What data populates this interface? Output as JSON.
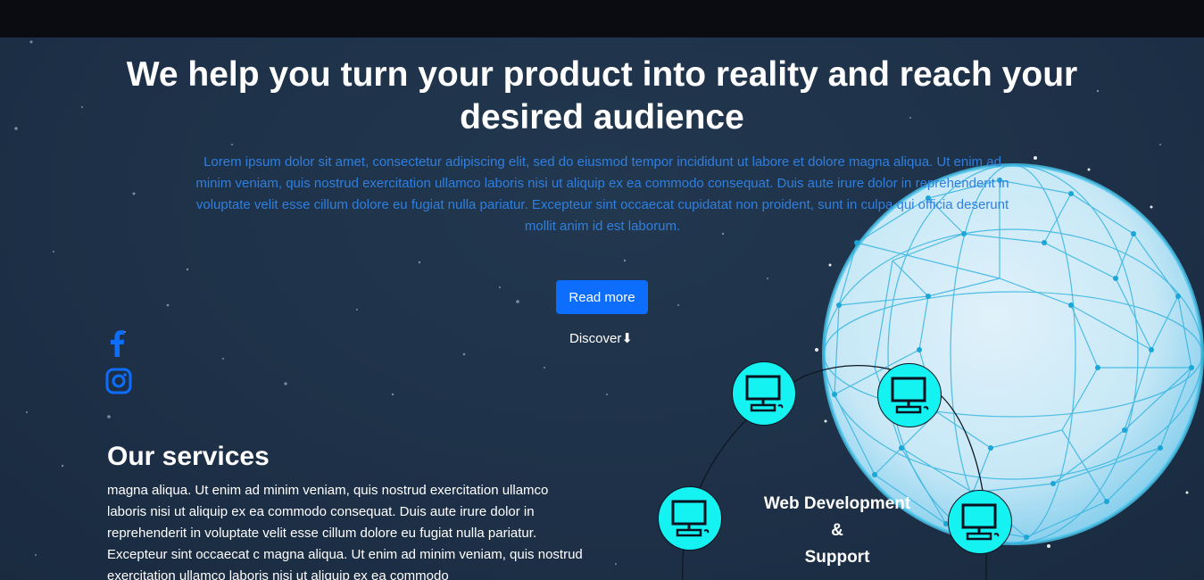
{
  "hero": {
    "headline": "We help you turn your product into reality and reach your desired audience",
    "lead": "Lorem ipsum dolor sit amet, consectetur adipiscing elit, sed do eiusmod tempor incididunt ut labore et dolore magna aliqua. Ut enim ad minim veniam, quis nostrud exercitation ullamco laboris nisi ut aliquip ex ea commodo consequat. Duis aute irure dolor in reprehenderit in voluptate velit esse cillum dolore eu fugiat nulla pariatur. Excepteur sint occaecat cupidatat non proident, sunt in culpa qui officia deserunt mollit anim id est laborum.",
    "read_more_label": "Read more",
    "discover_label": "Discover",
    "discover_arrow": "⬇"
  },
  "social": {
    "facebook_icon": "facebook-icon",
    "instagram_icon": "instagram-icon",
    "color": "#0d6efd"
  },
  "services": {
    "title": "Our services",
    "text": "magna aliqua. Ut enim ad minim veniam, quis nostrud exercitation ullamco laboris nisi ut aliquip ex ea commodo consequat. Duis aute irure dolor in reprehenderit in voluptate velit esse cillum dolore eu fugiat nulla pariatur. Excepteur sint occaecat c magna aliqua. Ut enim ad minim veniam, quis nostrud exercitation ullamco laboris nisi ut aliquip ex ea commodo",
    "label_line1": "Web Development",
    "label_line2": "&",
    "label_line3": "Support",
    "node_icon": "computer-monitor-icon",
    "node_color": "#14f2f2"
  },
  "colors": {
    "topbar": "#0b0c11",
    "background": "#1e3249",
    "accent": "#0d6efd",
    "lead_text": "#2f7fe0"
  }
}
